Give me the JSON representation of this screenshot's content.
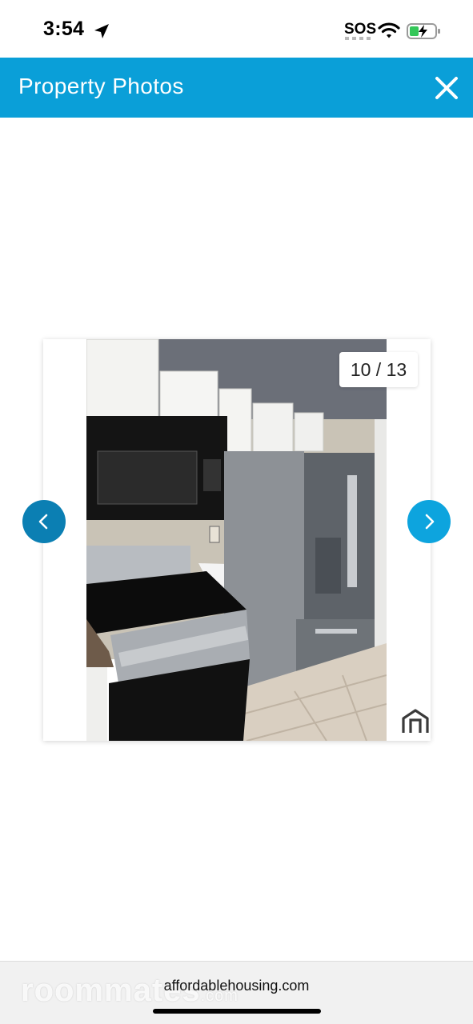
{
  "status_bar": {
    "time": "3:54",
    "sos": "SOS",
    "icons": [
      "location-arrow-icon",
      "wifi-icon",
      "battery-charging-icon"
    ]
  },
  "header": {
    "title": "Property Photos",
    "close_icon": "close-icon",
    "background_color": "#0a9fd8"
  },
  "gallery": {
    "counter": "10 / 13",
    "photo_description_icon": "kitchen-photo",
    "prev_icon": "chevron-left-icon",
    "next_icon": "chevron-right-icon",
    "corner_icon": "home-logo-icon"
  },
  "footer": {
    "watermark": "roommates",
    "watermark_suffix": ".com",
    "domain": "affordablehousing.com"
  }
}
